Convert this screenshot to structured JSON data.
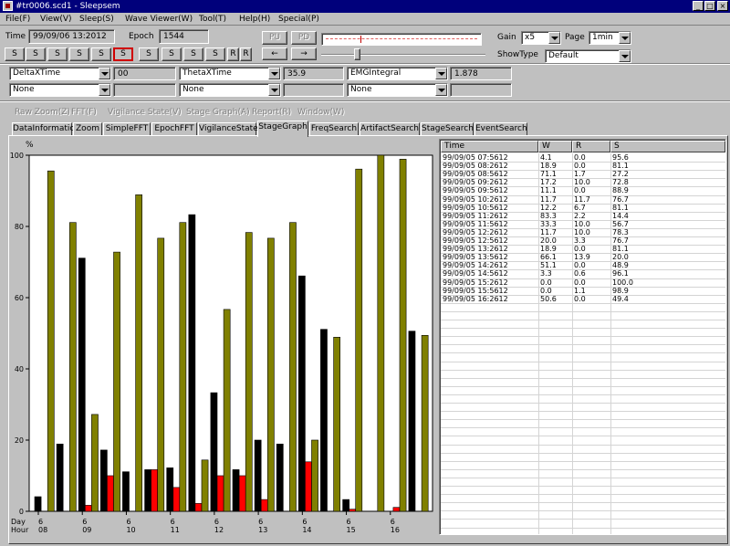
{
  "window": {
    "title": "#tr0006.scd1 - Sleepsem",
    "minimize": "_",
    "maximize": "□",
    "close": "×"
  },
  "menu": [
    "File(F)",
    "View(V)",
    "Sleep(S)",
    "Wave Viewer(W)",
    "Tool(T)",
    "Help(H)",
    "Special(P)"
  ],
  "toolbar": {
    "time_label": "Time",
    "time_value": "99/09/06 13:2012",
    "epoch_label": "Epoch",
    "epoch_value": "1544",
    "stage_buttons": [
      "S",
      "S",
      "S",
      "S",
      "S",
      "S",
      "S",
      "S",
      "S",
      "S",
      "R",
      "R"
    ],
    "selected_button": 5,
    "small_btn_1": "PU",
    "small_btn_2": "PD",
    "nav_left": "←",
    "nav_right": "→",
    "gain_label": "Gain",
    "gain_value": "x5",
    "page_label": "Page",
    "page_value": "1min",
    "showtype_label": "ShowType",
    "showtype_value": "Default"
  },
  "params": {
    "row1": [
      {
        "name": "DeltaXTime",
        "value": "00"
      },
      {
        "name": "ThetaXTime",
        "value": "35.9"
      },
      {
        "name": "EMGIntegral",
        "value": "1.878"
      }
    ],
    "row2": [
      "None",
      "None",
      "None"
    ]
  },
  "submenu": [
    "Raw Zoom(Z)",
    "FFT(F)",
    "Vigilance State(V)",
    "Stage Graph(A)",
    "Report(R)",
    "Window(W)"
  ],
  "tabs": [
    "DataInformation",
    "Zoom",
    "SimpleFFT",
    "EpochFFT",
    "VigilanceState",
    "StageGraph",
    "FreqSearch",
    "ArtifactSearch",
    "StageSearch",
    "EventSearch"
  ],
  "active_tab": 5,
  "table": {
    "headers": [
      "Time",
      "W",
      "R",
      "S"
    ],
    "rows": [
      [
        "99/09/05 07:5612",
        "4.1",
        "0.0",
        "95.6"
      ],
      [
        "99/09/05 08:2612",
        "18.9",
        "0.0",
        "81.1"
      ],
      [
        "99/09/05 08:5612",
        "71.1",
        "1.7",
        "27.2"
      ],
      [
        "99/09/05 09:2612",
        "17.2",
        "10.0",
        "72.8"
      ],
      [
        "99/09/05 09:5612",
        "11.1",
        "0.0",
        "88.9"
      ],
      [
        "99/09/05 10:2612",
        "11.7",
        "11.7",
        "76.7"
      ],
      [
        "99/09/05 10:5612",
        "12.2",
        "6.7",
        "81.1"
      ],
      [
        "99/09/05 11:2612",
        "83.3",
        "2.2",
        "14.4"
      ],
      [
        "99/09/05 11:5612",
        "33.3",
        "10.0",
        "56.7"
      ],
      [
        "99/09/05 12:2612",
        "11.7",
        "10.0",
        "78.3"
      ],
      [
        "99/09/05 12:5612",
        "20.0",
        "3.3",
        "76.7"
      ],
      [
        "99/09/05 13:2612",
        "18.9",
        "0.0",
        "81.1"
      ],
      [
        "99/09/05 13:5612",
        "66.1",
        "13.9",
        "20.0"
      ],
      [
        "99/09/05 14:2612",
        "51.1",
        "0.0",
        "48.9"
      ],
      [
        "99/09/05 14:5612",
        "3.3",
        "0.6",
        "96.1"
      ],
      [
        "99/09/05 15:2612",
        "0.0",
        "0.0",
        "100.0"
      ],
      [
        "99/09/05 15:5612",
        "0.0",
        "1.1",
        "98.9"
      ],
      [
        "99/09/05 16:2612",
        "50.6",
        "0.0",
        "49.4"
      ]
    ]
  },
  "chart_data": {
    "type": "bar",
    "ylabel": "%",
    "ylim": [
      0,
      100
    ],
    "yticks": [
      0,
      20,
      40,
      60,
      80,
      100
    ],
    "grid": false,
    "xlabel_rows": [
      "Day",
      "Hour"
    ],
    "x_ticks": [
      {
        "day": "6",
        "hour": "08",
        "index": 0
      },
      {
        "day": "6",
        "hour": "09",
        "index": 2
      },
      {
        "day": "6",
        "hour": "10",
        "index": 4
      },
      {
        "day": "6",
        "hour": "11",
        "index": 6
      },
      {
        "day": "6",
        "hour": "12",
        "index": 8
      },
      {
        "day": "6",
        "hour": "13",
        "index": 10
      },
      {
        "day": "6",
        "hour": "14",
        "index": 12
      },
      {
        "day": "6",
        "hour": "15",
        "index": 14
      },
      {
        "day": "6",
        "hour": "16",
        "index": 16
      }
    ],
    "series": [
      {
        "key": "W",
        "color": "#000000",
        "values": [
          4.1,
          18.9,
          71.1,
          17.2,
          11.1,
          11.7,
          12.2,
          83.3,
          33.3,
          11.7,
          20.0,
          18.9,
          66.1,
          51.1,
          3.3,
          0.0,
          0.0,
          50.6
        ]
      },
      {
        "key": "R",
        "color": "#ff0000",
        "values": [
          0.0,
          0.0,
          1.7,
          10.0,
          0.0,
          11.7,
          6.7,
          2.2,
          10.0,
          10.0,
          3.3,
          0.0,
          13.9,
          0.0,
          0.6,
          0.0,
          1.1,
          0.0
        ]
      },
      {
        "key": "S",
        "color": "#808000",
        "values": [
          95.6,
          81.1,
          27.2,
          72.8,
          88.9,
          76.7,
          81.1,
          14.4,
          56.7,
          78.3,
          76.7,
          81.1,
          20.0,
          48.9,
          96.1,
          100.0,
          98.9,
          49.4
        ]
      }
    ]
  }
}
